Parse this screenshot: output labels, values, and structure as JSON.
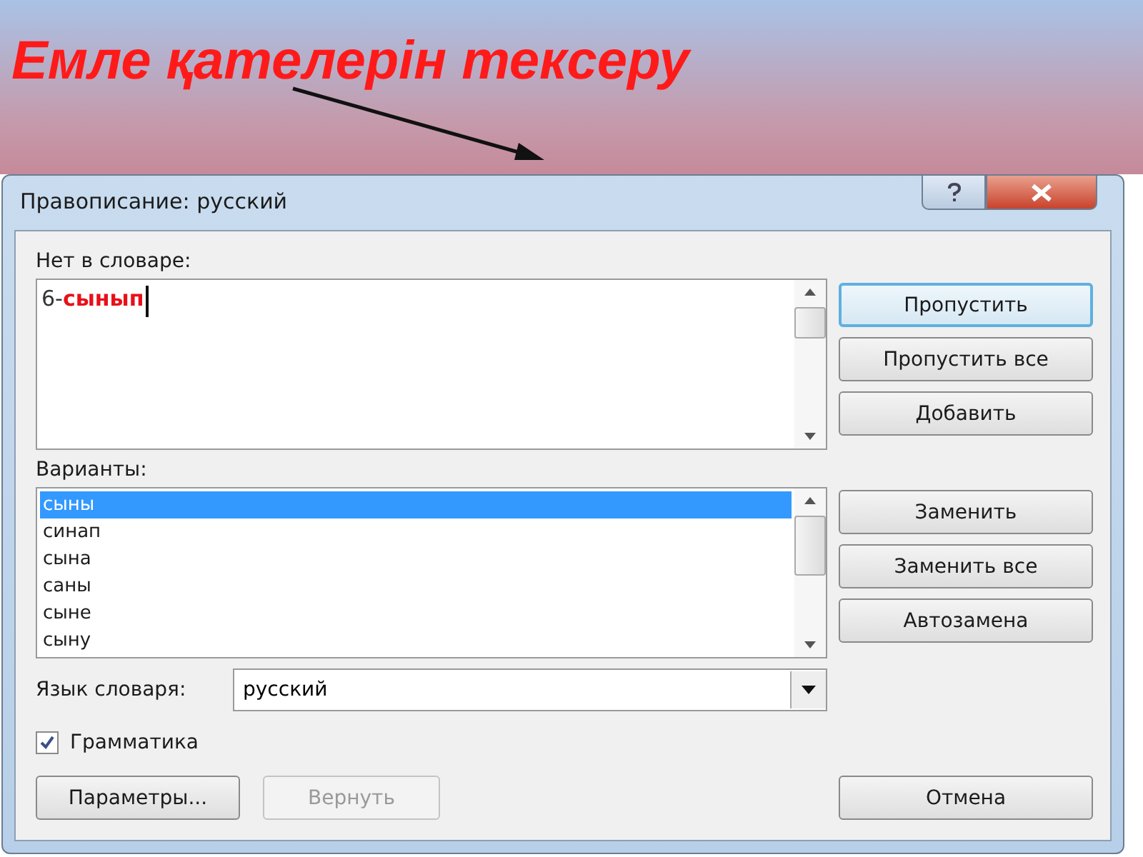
{
  "slide_title": "Емле қателерін тексеру",
  "dialog": {
    "title": "Правописание: русский",
    "not_in_dictionary": {
      "label": "Нет в словаре:",
      "value": [
        {
          "text": "6-",
          "error": false
        },
        {
          "text": "сынып",
          "error": true
        }
      ]
    },
    "suggestions": {
      "label": "Варианты:",
      "items": [
        {
          "text": "сыны",
          "selected": true
        },
        {
          "text": "синап",
          "selected": false
        },
        {
          "text": "сына",
          "selected": false
        },
        {
          "text": "саны",
          "selected": false
        },
        {
          "text": "сыне",
          "selected": false
        },
        {
          "text": "сыну",
          "selected": false
        }
      ]
    },
    "dictionary_language": {
      "label": "Язык словаря:",
      "value": "русский"
    },
    "grammar": {
      "label": "Грамматика",
      "checked": true
    },
    "top_buttons": [
      {
        "label": "Пропустить",
        "default": true
      },
      {
        "label": "Пропустить все",
        "default": false
      },
      {
        "label": "Добавить",
        "default": false
      }
    ],
    "replace_buttons": [
      {
        "label": "Заменить",
        "disabled": false
      },
      {
        "label": "Заменить все",
        "disabled": false
      },
      {
        "label": "Автозамена",
        "disabled": false
      }
    ],
    "bottom_buttons": [
      {
        "label": "Параметры...",
        "disabled": false
      },
      {
        "label": "Вернуть",
        "disabled": true
      }
    ],
    "cancel_button": {
      "label": "Отмена"
    }
  }
}
